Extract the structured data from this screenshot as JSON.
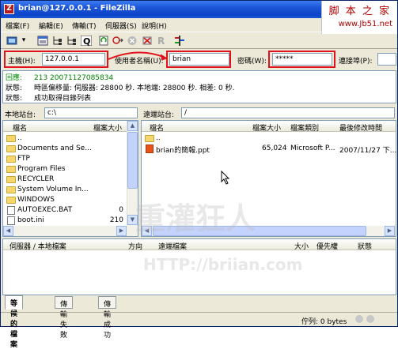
{
  "window": {
    "title": "brian@127.0.0.1 - FileZilla",
    "app_icon": "Z"
  },
  "watermark": {
    "site_cn": "脚 本 之 家",
    "site_url": "www.Jb51.net",
    "bg_brand": "重灌狂人",
    "bg_url": "HTTP://briian.com"
  },
  "menu": [
    "檔案(F)",
    "編輯(E)",
    "傳輸(T)",
    "伺服器(S)",
    "說明(H)"
  ],
  "toolbar_icons": [
    "site-manager-icon",
    "dropdown-arrow-icon",
    "toggle-log-icon",
    "toggle-local-tree-icon",
    "toggle-remote-tree-icon",
    "toggle-queue-icon",
    "refresh-icon",
    "process-queue-icon",
    "cancel-icon",
    "disconnect-icon",
    "reconnect-icon",
    "compare-icon"
  ],
  "quickconnect": {
    "host_label": "主機(H):",
    "host_value": "127.0.0.1",
    "user_label": "使用者名稱(U):",
    "user_value": "brian",
    "pass_label": "密碼(W):",
    "pass_value": "*****",
    "port_label": "連接埠(P):",
    "port_value": ""
  },
  "log": [
    {
      "label": "回應:",
      "text": "213 20071127085834",
      "color": "#008000"
    },
    {
      "label": "狀態:",
      "text": "時區偏移量: 伺服器: 28800 秒. 本地端: 28800 秒. 相差: 0 秒.",
      "color": "#000000"
    },
    {
      "label": "狀態:",
      "text": "成功取得目錄列表",
      "color": "#000000"
    }
  ],
  "local": {
    "site_label": "本地站台:",
    "path": "c:\\",
    "col_name": "檔名",
    "col_size": "檔案大小",
    "files": [
      {
        "name": "..",
        "size": "",
        "type": "folder"
      },
      {
        "name": "Documents and Se...",
        "size": "",
        "type": "folder"
      },
      {
        "name": "FTP",
        "size": "",
        "type": "folder"
      },
      {
        "name": "Program Files",
        "size": "",
        "type": "folder"
      },
      {
        "name": "RECYCLER",
        "size": "",
        "type": "folder"
      },
      {
        "name": "System Volume In...",
        "size": "",
        "type": "folder"
      },
      {
        "name": "WINDOWS",
        "size": "",
        "type": "folder"
      },
      {
        "name": "AUTOEXEC.BAT",
        "size": "0",
        "type": "file"
      },
      {
        "name": "boot.ini",
        "size": "210",
        "type": "file"
      }
    ]
  },
  "remote": {
    "site_label": "遠端站台:",
    "path": "/",
    "col_name": "檔名",
    "col_size": "檔案大小",
    "col_type": "檔案類別",
    "col_date": "最後修改時間",
    "files": [
      {
        "name": "..",
        "size": "",
        "kind": "",
        "date": "",
        "type": "folder"
      },
      {
        "name": "brian的簡報.ppt",
        "size": "65,024",
        "kind": "Microsoft P...",
        "date": "2007/11/27 下...",
        "type": "file"
      }
    ]
  },
  "queue": {
    "col_server": "伺服器 / 本地檔案",
    "col_dir": "方向",
    "col_remote": "遠端檔案",
    "col_size": "大小",
    "col_priority": "優先權",
    "col_status": "狀態"
  },
  "tabs": [
    "等候的檔案",
    "傳輸失敗",
    "傳輸成功"
  ],
  "status": {
    "queue": "佇列: 0 bytes"
  }
}
